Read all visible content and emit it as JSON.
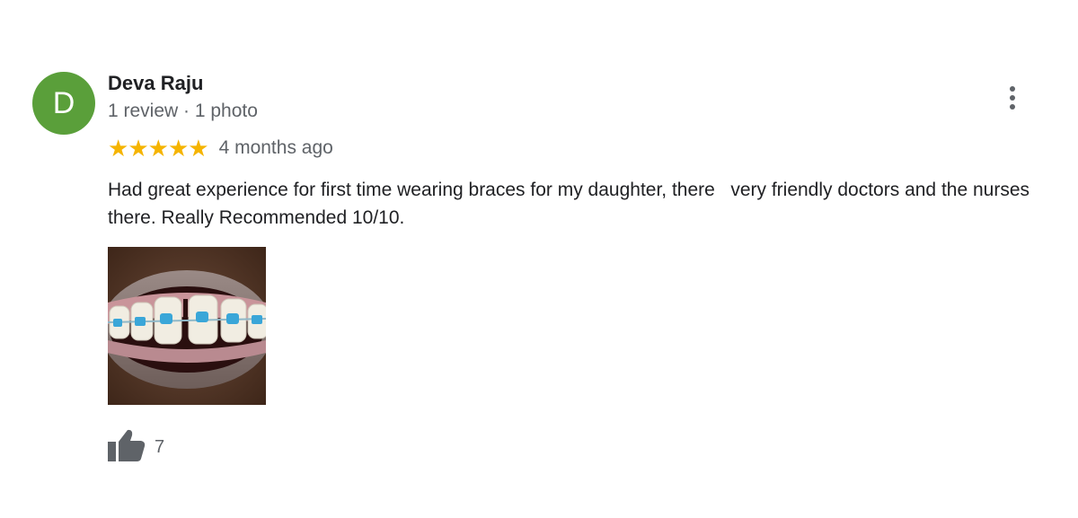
{
  "review": {
    "author": {
      "initial": "D",
      "name": "Deva Raju",
      "meta": "1 review · 1 photo",
      "avatar_color": "#5a9f3a"
    },
    "rating": 5,
    "rating_max": 5,
    "star_color": "#f5b400",
    "time": "4 months ago",
    "text": "Had great experience for first time wearing braces for my daughter, there   very friendly doctors and the nurses there. Really Recommended 10/10.",
    "photo_icon": "photo-thumbnail",
    "like_icon": "thumbs-up-icon",
    "like_count": "7",
    "more_icon": "more-vert-icon"
  }
}
